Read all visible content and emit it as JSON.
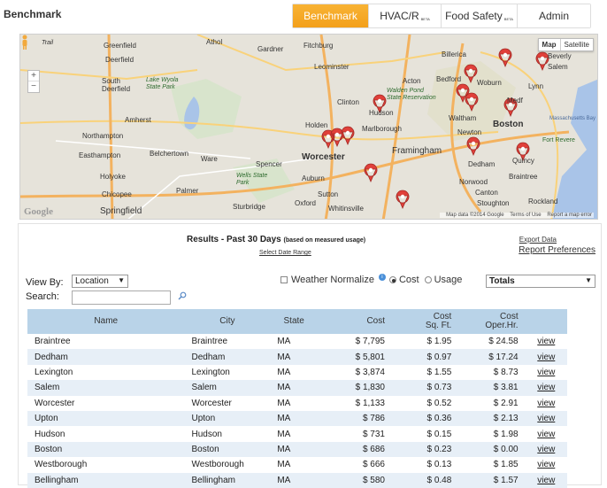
{
  "header": {
    "title": "Benchmark",
    "tabs": [
      {
        "label": "Benchmark",
        "beta": "",
        "active": true
      },
      {
        "label": "HVAC/R",
        "beta": "BETA",
        "active": false
      },
      {
        "label": "Food Safety",
        "beta": "BETA",
        "active": false
      },
      {
        "label": "Admin",
        "beta": "",
        "active": false
      }
    ]
  },
  "map": {
    "type_buttons": {
      "map": "Map",
      "satellite": "Satellite"
    },
    "logo": "Google",
    "credits": {
      "data": "Map data ©2014 Google",
      "terms": "Terms of Use",
      "report": "Report a map error"
    },
    "zoom": {
      "in": "+",
      "out": "−"
    },
    "towns": {
      "greenfield": "Greenfield",
      "athol": "Athol",
      "gardner": "Gardner",
      "fitchburg": "Fitchburg",
      "leominster": "Leominster",
      "billerica": "Billerica",
      "deerfield": "Deerfield",
      "south_deerfield": "South Deerfield",
      "lake_wyola": "Lake Wyola State Park",
      "amherst": "Amherst",
      "northampton": "Northampton",
      "easthampton": "Easthampton",
      "belchertown": "Belchertown",
      "ware": "Ware",
      "holyoke": "Holyoke",
      "chicopee": "Chicopee",
      "springfield": "Springfield",
      "palmer": "Palmer",
      "spencer": "Spencer",
      "wells": "Wells State Park",
      "sturbridge": "Sturbridge",
      "oxford": "Oxford",
      "worcester": "Worcester",
      "holden": "Holden",
      "auburn": "Auburn",
      "clinton": "Clinton",
      "hudson": "Hudson",
      "marlborough": "Marlborough",
      "framingham": "Framingham",
      "acton": "Acton",
      "bedford": "Bedford",
      "walden": "Walden Pond State Reservation",
      "woburn": "Woburn",
      "waltham": "Waltham",
      "newton": "Newton",
      "boston": "Boston",
      "medford": "Medf",
      "lynn": "Lynn",
      "salem": "Salem",
      "beverly": "Beverly",
      "dedham": "Dedham",
      "quincy": "Quincy",
      "braintree": "Braintree",
      "norwood": "Norwood",
      "canton": "Canton",
      "stoughton": "Stoughton",
      "rockland": "Rockland",
      "whitinsville": "Whitinsville",
      "sutton": "Sutton",
      "fort_revere": "Fort Revere",
      "massachusetts_bay": "Massachusetts Bay",
      "trail": "Trail"
    },
    "routes": [
      "2",
      "202",
      "2",
      "12",
      "190",
      "495",
      "95",
      "3",
      "1",
      "9",
      "116",
      "91",
      "181",
      "21",
      "32",
      "56",
      "122",
      "20",
      "90",
      "146",
      "16",
      "290",
      "1A",
      "128",
      "62",
      "128",
      "93",
      "28",
      "3A",
      "27",
      "24"
    ]
  },
  "results": {
    "title": "Results - Past 30 Days",
    "title_note": "(based on measured usage)",
    "select_range": "Select Date Range",
    "export": "Export Data",
    "report_prefs": "Report Preferences",
    "view_by_label": "View By:",
    "view_by_value": "Location",
    "search_label": "Search:",
    "search_placeholder": "",
    "weather_label": "Weather Normalize",
    "cost_label": "Cost",
    "usage_label": "Usage",
    "metric_value": "Totals",
    "columns": {
      "name": "Name",
      "city": "City",
      "state": "State",
      "cost": "Cost",
      "cost_sqft_1": "Cost",
      "cost_sqft_2": "Sq. Ft.",
      "cost_oper_1": "Cost",
      "cost_oper_2": "Oper.Hr."
    },
    "rows": [
      {
        "name": "Braintree",
        "city": "Braintree",
        "state": "MA",
        "cost": "$ 7,795",
        "sqft": "$ 1.95",
        "oper": "$ 24.58",
        "view": "view"
      },
      {
        "name": "Dedham",
        "city": "Dedham",
        "state": "MA",
        "cost": "$ 5,801",
        "sqft": "$ 0.97",
        "oper": "$ 17.24",
        "view": "view"
      },
      {
        "name": "Lexington",
        "city": "Lexington",
        "state": "MA",
        "cost": "$ 3,874",
        "sqft": "$ 1.55",
        "oper": "$ 8.73",
        "view": "view"
      },
      {
        "name": "Salem",
        "city": "Salem",
        "state": "MA",
        "cost": "$ 1,830",
        "sqft": "$ 0.73",
        "oper": "$ 3.81",
        "view": "view"
      },
      {
        "name": "Worcester",
        "city": "Worcester",
        "state": "MA",
        "cost": "$ 1,133",
        "sqft": "$ 0.52",
        "oper": "$ 2.91",
        "view": "view"
      },
      {
        "name": "Upton",
        "city": "Upton",
        "state": "MA",
        "cost": "$ 786",
        "sqft": "$ 0.36",
        "oper": "$ 2.13",
        "view": "view"
      },
      {
        "name": "Hudson",
        "city": "Hudson",
        "state": "MA",
        "cost": "$ 731",
        "sqft": "$ 0.15",
        "oper": "$ 1.98",
        "view": "view"
      },
      {
        "name": "Boston",
        "city": "Boston",
        "state": "MA",
        "cost": "$ 686",
        "sqft": "$ 0.23",
        "oper": "$ 0.00",
        "view": "view"
      },
      {
        "name": "Westborough",
        "city": "Westborough",
        "state": "MA",
        "cost": "$ 666",
        "sqft": "$ 0.13",
        "oper": "$ 1.85",
        "view": "view"
      },
      {
        "name": "Bellingham",
        "city": "Bellingham",
        "state": "MA",
        "cost": "$ 580",
        "sqft": "$ 0.48",
        "oper": "$ 1.57",
        "view": "view"
      }
    ]
  },
  "colors": {
    "tab_active": "#f3a01b",
    "marker": "#e0403a",
    "table_header": "#b9d3e8",
    "row_alt": "#e7eff7"
  }
}
